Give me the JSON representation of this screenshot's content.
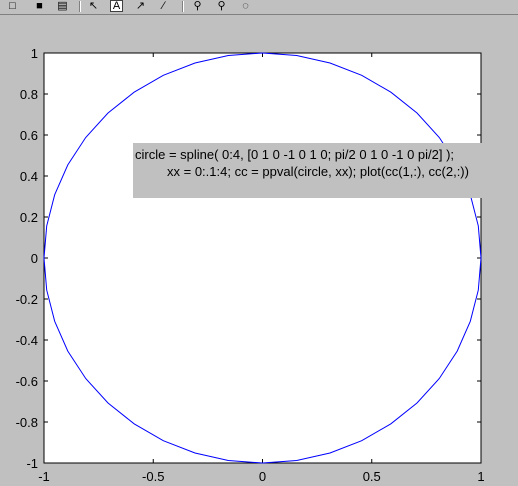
{
  "toolbar": {
    "icons": [
      "new-figure-icon",
      "save-icon",
      "print-icon",
      "arrow-cursor-icon",
      "text-insert-icon",
      "arrow-insert-icon",
      "line-insert-icon",
      "zoom-in-icon",
      "zoom-out-icon",
      "rotate-icon"
    ],
    "text_tool_label": "A"
  },
  "annotation": {
    "line1": "circle = spline( 0:4, [0 1 0 -1 0 1 0; pi/2 0 1 0 -1 0 pi/2] );",
    "line2": "xx = 0:.1:4; cc = ppval(circle, xx); plot(cc(1,:), cc(2,:))"
  },
  "colors": {
    "background": "#c0c0c0",
    "plot_area": "#ffffff",
    "series": "#0000ff",
    "axes": "#000000"
  },
  "chart_data": {
    "type": "line",
    "title": "",
    "xlabel": "",
    "ylabel": "",
    "xlim": [
      -1,
      1
    ],
    "ylim": [
      -1,
      1
    ],
    "xticks": [
      -1,
      -0.5,
      0,
      0.5,
      1
    ],
    "xtick_labels": [
      "-1",
      "-0.5",
      "0",
      "0.5",
      "1"
    ],
    "yticks": [
      -1,
      -0.8,
      -0.6,
      -0.4,
      -0.2,
      0,
      0.2,
      0.4,
      0.6,
      0.8,
      1
    ],
    "ytick_labels": [
      "-1",
      "-0.8",
      "-0.6",
      "-0.4",
      "-0.2",
      "0",
      "0.2",
      "0.4",
      "0.6",
      "0.8",
      "1"
    ],
    "grid": false,
    "series": [
      {
        "color": "#0000ff",
        "x": [
          0,
          0.1564,
          0.309,
          0.454,
          0.5878,
          0.7071,
          0.809,
          0.891,
          0.9511,
          0.9877,
          1,
          0.9877,
          0.9511,
          0.891,
          0.809,
          0.7071,
          0.5878,
          0.454,
          0.309,
          0.1564,
          0,
          -0.1564,
          -0.309,
          -0.454,
          -0.5878,
          -0.7071,
          -0.809,
          -0.891,
          -0.9511,
          -0.9877,
          -1,
          -0.9877,
          -0.9511,
          -0.891,
          -0.809,
          -0.7071,
          -0.5878,
          -0.454,
          -0.309,
          -0.1564,
          0
        ],
        "y": [
          1,
          0.9877,
          0.9511,
          0.891,
          0.809,
          0.7071,
          0.5878,
          0.454,
          0.309,
          0.1564,
          0,
          -0.1564,
          -0.309,
          -0.454,
          -0.5878,
          -0.7071,
          -0.809,
          -0.891,
          -0.9511,
          -0.9877,
          -1,
          -0.9877,
          -0.9511,
          -0.891,
          -0.809,
          -0.7071,
          -0.5878,
          -0.454,
          -0.309,
          -0.1564,
          0,
          0.1564,
          0.309,
          0.454,
          0.5878,
          0.7071,
          0.809,
          0.891,
          0.9511,
          0.9877,
          1
        ]
      }
    ]
  }
}
